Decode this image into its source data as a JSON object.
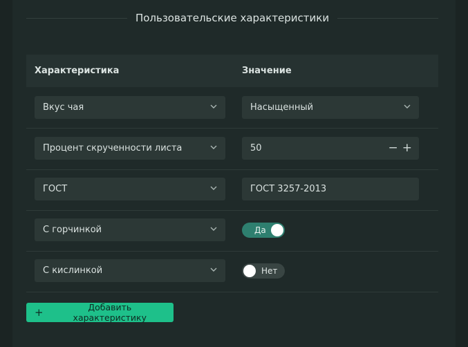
{
  "section": {
    "title": "Пользовательские характеристики"
  },
  "table": {
    "headers": {
      "name": "Характеристика",
      "value": "Значение"
    },
    "rows": [
      {
        "name": "Вкус чая",
        "value": "Насыщенный",
        "value_type": "select"
      },
      {
        "name": "Процент скрученности листа",
        "value": "50",
        "value_type": "number",
        "decrement_label": "−",
        "increment_label": "+"
      },
      {
        "name": "ГОСТ",
        "value": "ГОСТ 3257-2013",
        "value_type": "text"
      },
      {
        "name": "С горчинкой",
        "value": "Да",
        "value_type": "toggle",
        "toggle_state": true
      },
      {
        "name": "С кислинкой",
        "value": "Нет",
        "value_type": "toggle",
        "toggle_state": false
      }
    ]
  },
  "add_button": {
    "icon": "plus-icon",
    "label": "Добавить характеристику"
  },
  "colors": {
    "background": "#1b2423",
    "panel": "#1f2a29",
    "field": "#2c3836",
    "accent": "#1ec08a",
    "toggle_on": "#2e7f6f",
    "toggle_off": "#394543"
  }
}
